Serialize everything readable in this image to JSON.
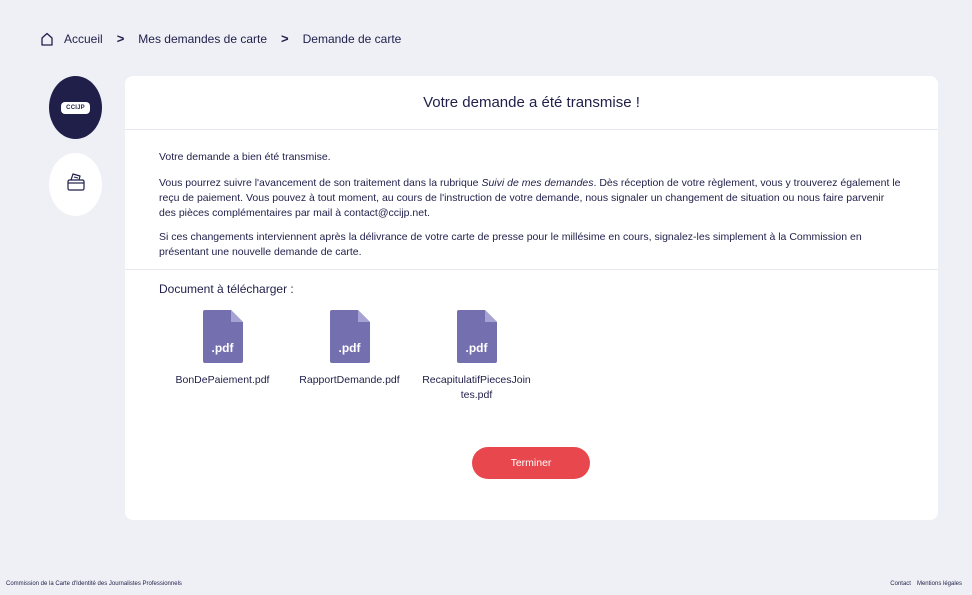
{
  "breadcrumb": {
    "home_icon": "home-icon",
    "items": [
      "Accueil",
      "Mes demandes de carte",
      "Demande de carte"
    ],
    "separator": ">"
  },
  "steps": [
    {
      "icon": "ccip-logo-icon",
      "badge": "CCIJP",
      "active": true
    },
    {
      "icon": "press-card-icon",
      "active": false
    }
  ],
  "card": {
    "title": "Votre demande a été transmise !",
    "paragraphs": {
      "p1": "Votre demande a bien été transmise.",
      "p2_before": "Vous pourrez suivre l'avancement de son traitement dans la rubrique ",
      "p2_italic": "Suivi de mes demandes",
      "p2_after": ". Dès réception de votre règlement, vous y trouverez également le reçu de paiement. Vous pouvez à tout moment, au cours de l'instruction de votre demande, nous signaler un changement de situation ou nous faire parvenir des pièces complémentaires par mail à contact@ccijp.net.",
      "p3": "Si ces changements interviennent après la délivrance de votre carte de presse pour le millésime en cours, signalez-les simplement à la Commission en présentant une nouvelle demande de carte."
    }
  },
  "downloads": {
    "title": "Document à télécharger :",
    "files": [
      {
        "name": "BonDePaiement.pdf",
        "ext": ".pdf"
      },
      {
        "name": "RapportDemande.pdf",
        "ext": ".pdf"
      },
      {
        "name": "RecapitulatifPiecesJointes.pdf",
        "ext": ".pdf"
      }
    ]
  },
  "finish_button": "Terminer",
  "footer": {
    "left": "Commission de la Carte d'Identité des Journalistes Professionnels",
    "contact": "Contact",
    "legal": "Mentions légales"
  },
  "colors": {
    "navy": "#1f1f4a",
    "background": "#eef0f5",
    "accent_red": "#e8484d",
    "pdf_purple": "#7470b0"
  }
}
